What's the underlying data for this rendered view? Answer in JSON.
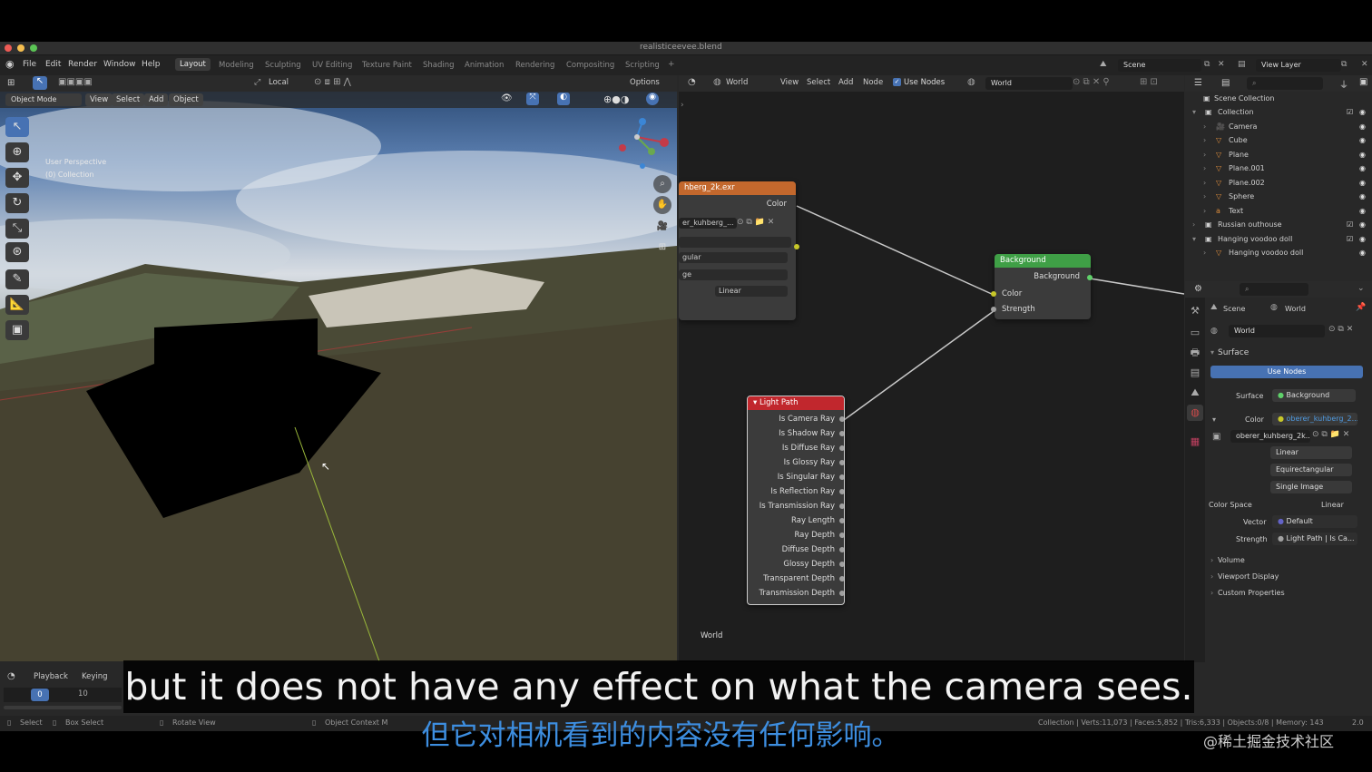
{
  "title_bar": {
    "file": "realisticeevee.blend"
  },
  "menu": [
    "File",
    "Edit",
    "Render",
    "Window",
    "Help"
  ],
  "workspaces": [
    "Layout",
    "Modeling",
    "Sculpting",
    "UV Editing",
    "Texture Paint",
    "Shading",
    "Animation",
    "Rendering",
    "Compositing",
    "Scripting"
  ],
  "scene": {
    "name": "Scene",
    "view_layer": "View Layer"
  },
  "viewport": {
    "transform": "Local",
    "options": "Options",
    "mode": "Object Mode",
    "menus": [
      "View",
      "Select",
      "Add",
      "Object"
    ],
    "overlay_title": "User Perspective",
    "overlay_collection": "(0) Collection"
  },
  "node_editor": {
    "type": "World",
    "menus": [
      "View",
      "Select",
      "Add",
      "Node"
    ],
    "use_nodes": "Use Nodes",
    "world_name": "World",
    "footer": "World",
    "image_node": {
      "title": "hberg_2k.exr",
      "out_color": "Color",
      "image_field": "er_kuhberg_...",
      "projection": "gular",
      "source": "ge",
      "interp": "Linear"
    },
    "background_node": {
      "title": "Background",
      "out": "Background",
      "in_color": "Color",
      "in_strength": "Strength"
    },
    "lightpath_node": {
      "title": "Light Path",
      "outputs": [
        "Is Camera Ray",
        "Is Shadow Ray",
        "Is Diffuse Ray",
        "Is Glossy Ray",
        "Is Singular Ray",
        "Is Reflection Ray",
        "Is Transmission Ray",
        "Ray Length",
        "Ray Depth",
        "Diffuse Depth",
        "Glossy Depth",
        "Transparent Depth",
        "Transmission Depth"
      ]
    }
  },
  "outliner": {
    "root": "Scene Collection",
    "items": [
      {
        "label": "Collection",
        "icon": "collection-icon",
        "color": "#cfcfcf"
      },
      {
        "label": "Camera",
        "icon": "camera-icon",
        "color": "#e08e3c"
      },
      {
        "label": "Cube",
        "icon": "mesh-icon",
        "color": "#e08e3c"
      },
      {
        "label": "Plane",
        "icon": "mesh-icon",
        "color": "#e08e3c"
      },
      {
        "label": "Plane.001",
        "icon": "mesh-icon",
        "color": "#e08e3c"
      },
      {
        "label": "Plane.002",
        "icon": "mesh-icon",
        "color": "#e08e3c"
      },
      {
        "label": "Sphere",
        "icon": "mesh-icon",
        "color": "#e08e3c"
      },
      {
        "label": "Text",
        "icon": "text-icon",
        "color": "#e08e3c"
      },
      {
        "label": "Russian outhouse",
        "icon": "collection-icon",
        "color": "#cfcfcf"
      },
      {
        "label": "Hanging voodoo doll",
        "icon": "collection-icon",
        "color": "#cfcfcf"
      },
      {
        "label": "Hanging voodoo doll",
        "icon": "mesh-icon",
        "color": "#e08e3c"
      }
    ]
  },
  "properties": {
    "crumb_scene": "Scene",
    "crumb_world": "World",
    "world_field": "World",
    "surface_panel": "Surface",
    "use_nodes_btn": "Use Nodes",
    "surface_label": "Surface",
    "surface_value": "Background",
    "color_label": "Color",
    "color_value": "oberer_kuhberg_2...",
    "image_value": "oberer_kuhberg_2k...",
    "interp": "Linear",
    "projection": "Equirectangular",
    "source": "Single Image",
    "colorspace_label": "Color Space",
    "colorspace_value": "Linear",
    "vector_label": "Vector",
    "vector_value": "Default",
    "strength_label": "Strength",
    "strength_value": "Light Path | Is Ca...",
    "panels": [
      "Volume",
      "Viewport Display",
      "Custom Properties"
    ]
  },
  "timeline": {
    "playback": "Playback",
    "keying": "Keying",
    "frame_current": "0",
    "frame_mark": "10"
  },
  "status": {
    "select": "Select",
    "box_select": "Box Select",
    "rotate": "Rotate View",
    "context": "Object Context M",
    "stats": "Collection | Verts:11,073 | Faces:5,852 | Tris:6,333 | Objects:0/8 | Memory: 143",
    "version": "2.0"
  },
  "subtitles": {
    "en": "but it does not have any effect on what the camera sees.",
    "cn": "但它对相机看到的内容没有任何影响。"
  },
  "watermark": "@稀土掘金技术社区",
  "colors": {
    "image_header": "#c3682d",
    "background_header": "#3f9f46",
    "lightpath_header": "#c1272d",
    "accent": "#4772b3",
    "subtitle_cn": "#3d8ee0"
  }
}
